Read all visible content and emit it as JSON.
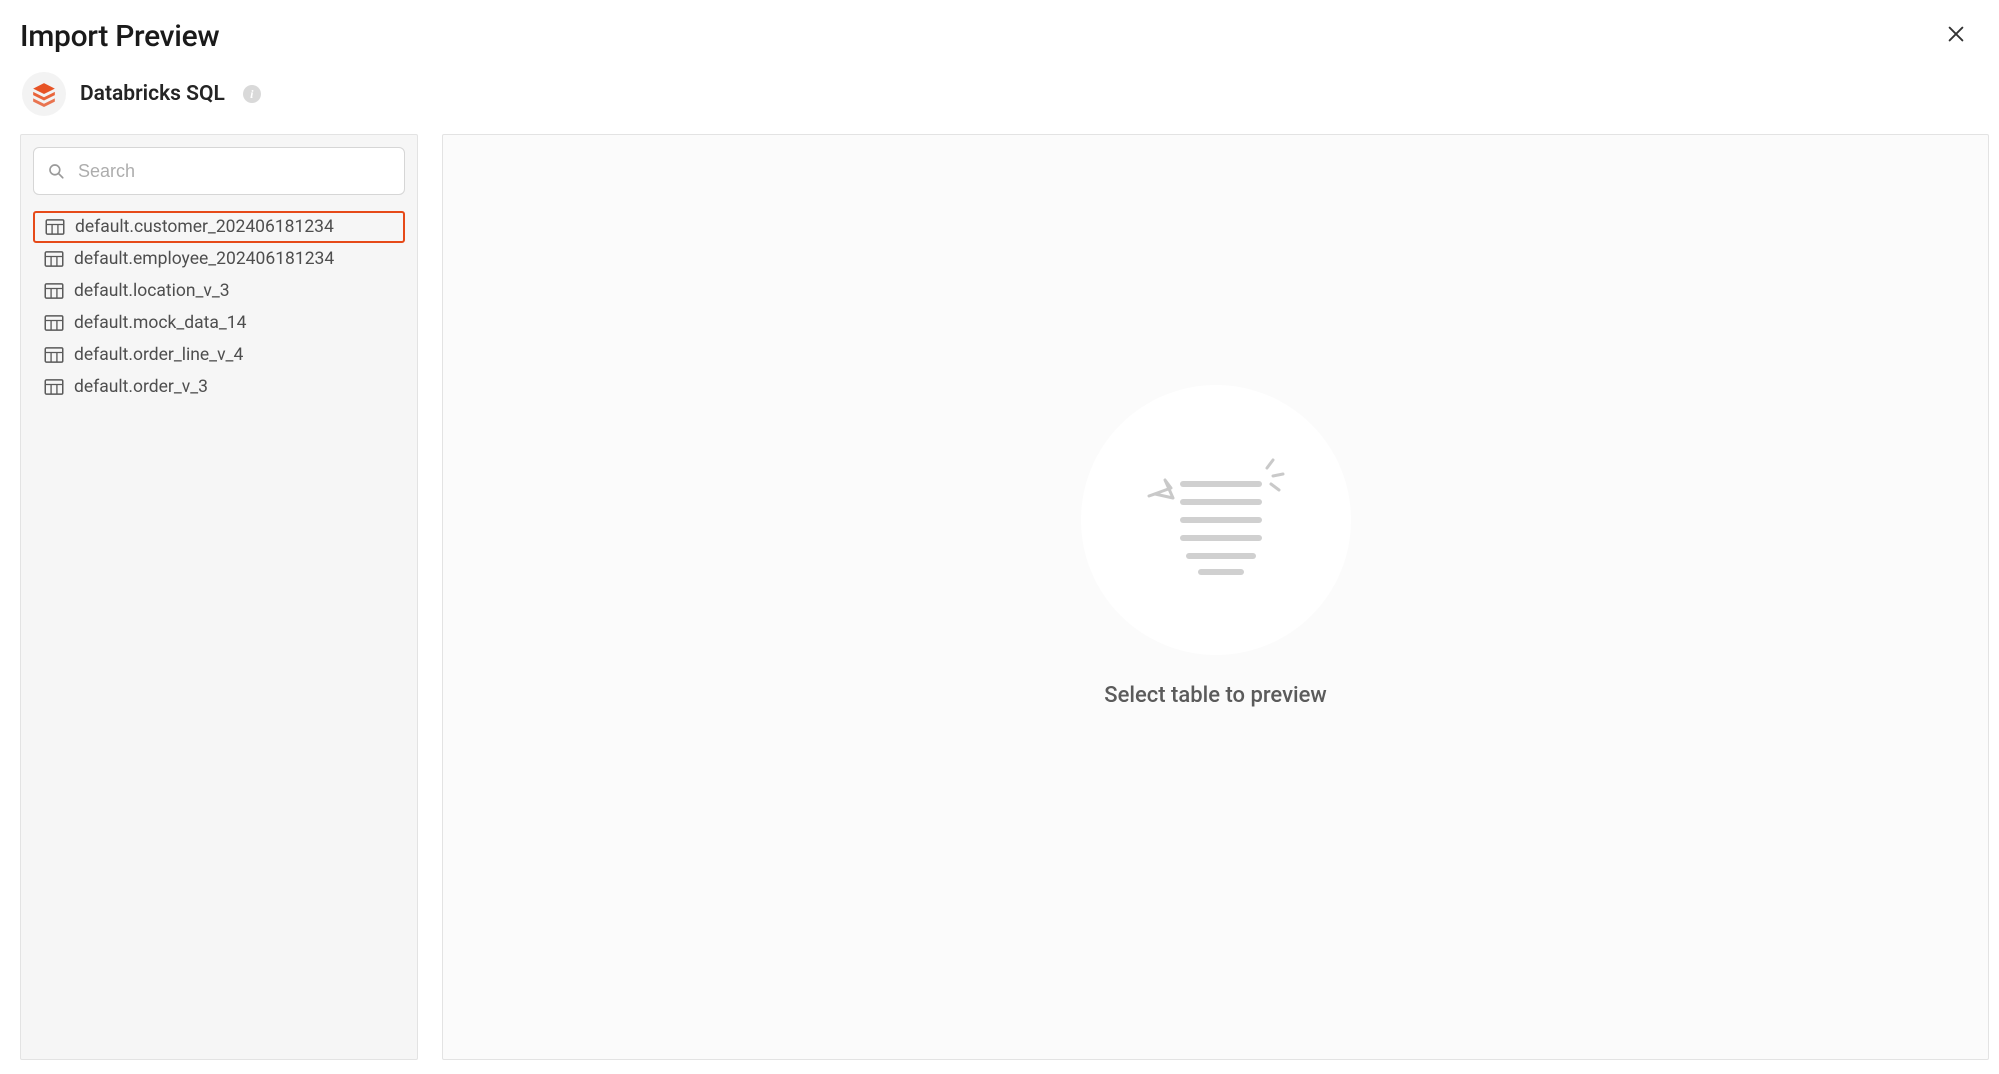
{
  "header": {
    "title": "Import Preview"
  },
  "source": {
    "name": "Databricks SQL"
  },
  "search": {
    "placeholder": "Search"
  },
  "tables": [
    {
      "name": "default.customer_202406181234",
      "selected": true
    },
    {
      "name": "default.employee_202406181234",
      "selected": false
    },
    {
      "name": "default.location_v_3",
      "selected": false
    },
    {
      "name": "default.mock_data_14",
      "selected": false
    },
    {
      "name": "default.order_line_v_4",
      "selected": false
    },
    {
      "name": "default.order_v_3",
      "selected": false
    }
  ],
  "preview": {
    "empty_message": "Select table to preview"
  },
  "icons": {
    "databricks": "databricks-icon",
    "info": "i"
  }
}
